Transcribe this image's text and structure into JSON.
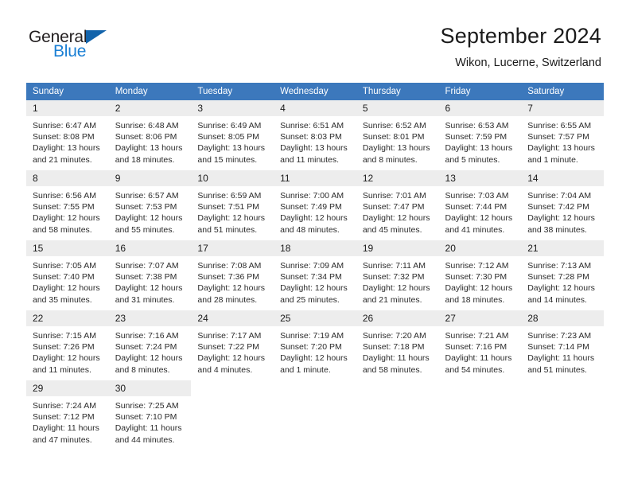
{
  "brand": {
    "name_part1": "General",
    "name_part2": "Blue",
    "triangle_color": "#1263ab",
    "blue_color": "#1a7fd4"
  },
  "header": {
    "title": "September 2024",
    "location": "Wikon, Lucerne, Switzerland"
  },
  "theme": {
    "header_bg": "#3c78bc",
    "daynum_bg": "#ededed",
    "separator": "#cfcfcf"
  },
  "weekdays": [
    "Sunday",
    "Monday",
    "Tuesday",
    "Wednesday",
    "Thursday",
    "Friday",
    "Saturday"
  ],
  "days": [
    {
      "n": "1",
      "sunrise": "Sunrise: 6:47 AM",
      "sunset": "Sunset: 8:08 PM",
      "daylight1": "Daylight: 13 hours",
      "daylight2": "and 21 minutes."
    },
    {
      "n": "2",
      "sunrise": "Sunrise: 6:48 AM",
      "sunset": "Sunset: 8:06 PM",
      "daylight1": "Daylight: 13 hours",
      "daylight2": "and 18 minutes."
    },
    {
      "n": "3",
      "sunrise": "Sunrise: 6:49 AM",
      "sunset": "Sunset: 8:05 PM",
      "daylight1": "Daylight: 13 hours",
      "daylight2": "and 15 minutes."
    },
    {
      "n": "4",
      "sunrise": "Sunrise: 6:51 AM",
      "sunset": "Sunset: 8:03 PM",
      "daylight1": "Daylight: 13 hours",
      "daylight2": "and 11 minutes."
    },
    {
      "n": "5",
      "sunrise": "Sunrise: 6:52 AM",
      "sunset": "Sunset: 8:01 PM",
      "daylight1": "Daylight: 13 hours",
      "daylight2": "and 8 minutes."
    },
    {
      "n": "6",
      "sunrise": "Sunrise: 6:53 AM",
      "sunset": "Sunset: 7:59 PM",
      "daylight1": "Daylight: 13 hours",
      "daylight2": "and 5 minutes."
    },
    {
      "n": "7",
      "sunrise": "Sunrise: 6:55 AM",
      "sunset": "Sunset: 7:57 PM",
      "daylight1": "Daylight: 13 hours",
      "daylight2": "and 1 minute."
    },
    {
      "n": "8",
      "sunrise": "Sunrise: 6:56 AM",
      "sunset": "Sunset: 7:55 PM",
      "daylight1": "Daylight: 12 hours",
      "daylight2": "and 58 minutes."
    },
    {
      "n": "9",
      "sunrise": "Sunrise: 6:57 AM",
      "sunset": "Sunset: 7:53 PM",
      "daylight1": "Daylight: 12 hours",
      "daylight2": "and 55 minutes."
    },
    {
      "n": "10",
      "sunrise": "Sunrise: 6:59 AM",
      "sunset": "Sunset: 7:51 PM",
      "daylight1": "Daylight: 12 hours",
      "daylight2": "and 51 minutes."
    },
    {
      "n": "11",
      "sunrise": "Sunrise: 7:00 AM",
      "sunset": "Sunset: 7:49 PM",
      "daylight1": "Daylight: 12 hours",
      "daylight2": "and 48 minutes."
    },
    {
      "n": "12",
      "sunrise": "Sunrise: 7:01 AM",
      "sunset": "Sunset: 7:47 PM",
      "daylight1": "Daylight: 12 hours",
      "daylight2": "and 45 minutes."
    },
    {
      "n": "13",
      "sunrise": "Sunrise: 7:03 AM",
      "sunset": "Sunset: 7:44 PM",
      "daylight1": "Daylight: 12 hours",
      "daylight2": "and 41 minutes."
    },
    {
      "n": "14",
      "sunrise": "Sunrise: 7:04 AM",
      "sunset": "Sunset: 7:42 PM",
      "daylight1": "Daylight: 12 hours",
      "daylight2": "and 38 minutes."
    },
    {
      "n": "15",
      "sunrise": "Sunrise: 7:05 AM",
      "sunset": "Sunset: 7:40 PM",
      "daylight1": "Daylight: 12 hours",
      "daylight2": "and 35 minutes."
    },
    {
      "n": "16",
      "sunrise": "Sunrise: 7:07 AM",
      "sunset": "Sunset: 7:38 PM",
      "daylight1": "Daylight: 12 hours",
      "daylight2": "and 31 minutes."
    },
    {
      "n": "17",
      "sunrise": "Sunrise: 7:08 AM",
      "sunset": "Sunset: 7:36 PM",
      "daylight1": "Daylight: 12 hours",
      "daylight2": "and 28 minutes."
    },
    {
      "n": "18",
      "sunrise": "Sunrise: 7:09 AM",
      "sunset": "Sunset: 7:34 PM",
      "daylight1": "Daylight: 12 hours",
      "daylight2": "and 25 minutes."
    },
    {
      "n": "19",
      "sunrise": "Sunrise: 7:11 AM",
      "sunset": "Sunset: 7:32 PM",
      "daylight1": "Daylight: 12 hours",
      "daylight2": "and 21 minutes."
    },
    {
      "n": "20",
      "sunrise": "Sunrise: 7:12 AM",
      "sunset": "Sunset: 7:30 PM",
      "daylight1": "Daylight: 12 hours",
      "daylight2": "and 18 minutes."
    },
    {
      "n": "21",
      "sunrise": "Sunrise: 7:13 AM",
      "sunset": "Sunset: 7:28 PM",
      "daylight1": "Daylight: 12 hours",
      "daylight2": "and 14 minutes."
    },
    {
      "n": "22",
      "sunrise": "Sunrise: 7:15 AM",
      "sunset": "Sunset: 7:26 PM",
      "daylight1": "Daylight: 12 hours",
      "daylight2": "and 11 minutes."
    },
    {
      "n": "23",
      "sunrise": "Sunrise: 7:16 AM",
      "sunset": "Sunset: 7:24 PM",
      "daylight1": "Daylight: 12 hours",
      "daylight2": "and 8 minutes."
    },
    {
      "n": "24",
      "sunrise": "Sunrise: 7:17 AM",
      "sunset": "Sunset: 7:22 PM",
      "daylight1": "Daylight: 12 hours",
      "daylight2": "and 4 minutes."
    },
    {
      "n": "25",
      "sunrise": "Sunrise: 7:19 AM",
      "sunset": "Sunset: 7:20 PM",
      "daylight1": "Daylight: 12 hours",
      "daylight2": "and 1 minute."
    },
    {
      "n": "26",
      "sunrise": "Sunrise: 7:20 AM",
      "sunset": "Sunset: 7:18 PM",
      "daylight1": "Daylight: 11 hours",
      "daylight2": "and 58 minutes."
    },
    {
      "n": "27",
      "sunrise": "Sunrise: 7:21 AM",
      "sunset": "Sunset: 7:16 PM",
      "daylight1": "Daylight: 11 hours",
      "daylight2": "and 54 minutes."
    },
    {
      "n": "28",
      "sunrise": "Sunrise: 7:23 AM",
      "sunset": "Sunset: 7:14 PM",
      "daylight1": "Daylight: 11 hours",
      "daylight2": "and 51 minutes."
    },
    {
      "n": "29",
      "sunrise": "Sunrise: 7:24 AM",
      "sunset": "Sunset: 7:12 PM",
      "daylight1": "Daylight: 11 hours",
      "daylight2": "and 47 minutes."
    },
    {
      "n": "30",
      "sunrise": "Sunrise: 7:25 AM",
      "sunset": "Sunset: 7:10 PM",
      "daylight1": "Daylight: 11 hours",
      "daylight2": "and 44 minutes."
    }
  ],
  "grid": {
    "first_day_column_index": 0,
    "weeks": 5
  }
}
